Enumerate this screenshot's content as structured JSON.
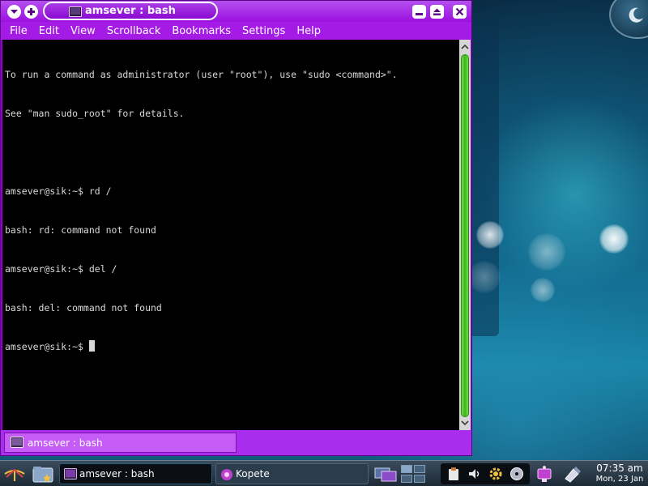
{
  "window": {
    "title": "amsever : bash",
    "menu": [
      "File",
      "Edit",
      "View",
      "Scrollback",
      "Bookmarks",
      "Settings",
      "Help"
    ]
  },
  "terminal": {
    "lines": [
      "To run a command as administrator (user \"root\"), use \"sudo <command>\".",
      "See \"man sudo_root\" for details.",
      "",
      "amsever@sik:~$ rd /",
      "bash: rd: command not found",
      "amsever@sik:~$ del /",
      "bash: del: command not found"
    ],
    "prompt": "amsever@sik:~$ "
  },
  "tabs": [
    {
      "label": "amsever : bash",
      "active": true
    }
  ],
  "taskbar": {
    "tasks": [
      {
        "label": "amsever : bash",
        "active": true
      },
      {
        "label": "Kopete",
        "active": false
      }
    ],
    "clock": {
      "time": "07:35 am",
      "date": "Mon, 23 Jan"
    }
  },
  "icons": {
    "window_menu": "chevron-down-icon",
    "sticky": "plus-icon",
    "minimize": "minimize-icon",
    "maximize": "maximize-icon",
    "close": "close-icon",
    "terminal": "terminal-icon",
    "kopete": "kopete-icon"
  },
  "colors": {
    "window_frame": "#9400d3",
    "terminal_bg": "#000000",
    "terminal_fg": "#d8d8d8",
    "scroll_thumb": "#3fb21c"
  }
}
